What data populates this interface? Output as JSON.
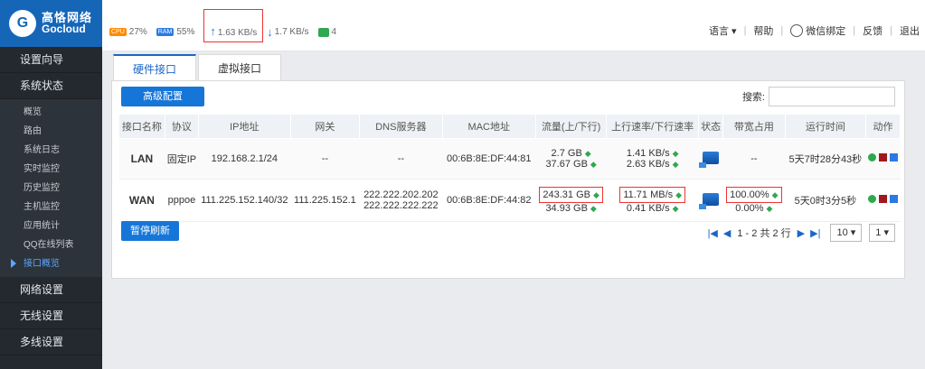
{
  "logo": {
    "cn": "高恪网络",
    "en": "Gocloud"
  },
  "sidebar": {
    "main_items": [
      "设置向导",
      "系统状态"
    ],
    "sub_items": [
      "概览",
      "路由",
      "系统日志",
      "实时监控",
      "历史监控",
      "主机监控",
      "应用统计",
      "QQ在线列表",
      "接口概览"
    ],
    "after_items": [
      "网络设置",
      "无线设置",
      "多线设置"
    ]
  },
  "topbar": {
    "cpu": "27%",
    "ram": "55%",
    "up": "1.63 KB/s",
    "down": "1.7 KB/s",
    "wifi": "4",
    "links": [
      "语言",
      "帮助",
      "微信绑定",
      "反馈",
      "退出"
    ]
  },
  "tabs": [
    "硬件接口",
    "虚拟接口"
  ],
  "buttons": {
    "advanced": "高级配置",
    "pause": "暂停刷新"
  },
  "search": {
    "label": "搜索:"
  },
  "table": {
    "headers": [
      "接口名称",
      "协议",
      "IP地址",
      "网关",
      "DNS服务器",
      "MAC地址",
      "流量(上/下行)",
      "上行速率/下行速率",
      "状态",
      "带宽占用",
      "运行时间",
      "动作"
    ],
    "rows": [
      {
        "name": "LAN",
        "proto": "固定IP",
        "ip": "192.168.2.1/24",
        "gw": "--",
        "dns1": "--",
        "dns2": "",
        "mac": "00:6B:8E:DF:44:81",
        "traffic_up": "2.7 GB",
        "traffic_down": "37.67 GB",
        "rate_up": "1.41 KB/s",
        "rate_down": "2.63 KB/s",
        "bw1": "--",
        "bw2": "",
        "uptime": "5天7时28分43秒"
      },
      {
        "name": "WAN",
        "proto": "pppoe",
        "ip": "111.225.152.140/32",
        "gw": "111.225.152.1",
        "dns1": "222.222.202.202",
        "dns2": "222.222.222.222",
        "mac": "00:6B:8E:DF:44:82",
        "traffic_up": "243.31 GB",
        "traffic_down": "34.93 GB",
        "rate_up": "11.71 MB/s",
        "rate_down": "0.41 KB/s",
        "bw1": "100.00%",
        "bw2": "0.00%",
        "uptime": "5天0时3分5秒"
      }
    ]
  },
  "pager": {
    "info": "1 - 2 共 2 行",
    "page_size": "10",
    "page": "1"
  }
}
